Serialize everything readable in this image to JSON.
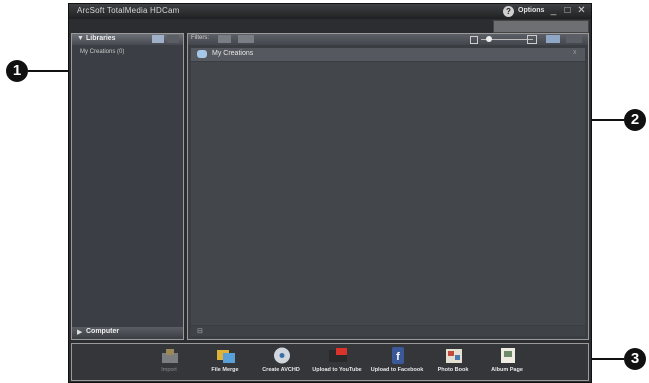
{
  "window": {
    "title": "ArcSoft TotalMedia HDCam",
    "options_label": "Options",
    "help_glyph": "?",
    "min_glyph": "_",
    "max_glyph": "□",
    "close_glyph": "✕"
  },
  "callouts": [
    "1",
    "2",
    "3"
  ],
  "left_panel": {
    "libraries_label": "Libraries",
    "libraries_items": [
      "My Creations (0)"
    ],
    "computer_label": "Computer",
    "expand_glyph": "▼",
    "collapsed_glyph": "▶"
  },
  "main_panel": {
    "filters_label": "Filters:",
    "section_title": "My Creations",
    "section_close_glyph": "x",
    "footer_glyph": "⊟"
  },
  "toolbar": {
    "items": [
      {
        "label": "Import",
        "icon": "import-icon",
        "enabled": false
      },
      {
        "label": "File Merge",
        "icon": "file-merge-icon",
        "enabled": true
      },
      {
        "label": "Create AVCHD",
        "icon": "disc-icon",
        "enabled": true
      },
      {
        "label": "Upload to YouTube",
        "icon": "youtube-icon",
        "enabled": true
      },
      {
        "label": "Upload to Facebook",
        "icon": "facebook-icon",
        "enabled": true
      },
      {
        "label": "Photo Book",
        "icon": "photo-book-icon",
        "enabled": true
      },
      {
        "label": "Album Page",
        "icon": "album-page-icon",
        "enabled": true
      }
    ]
  },
  "colors": {
    "accent": "#8fa6c5",
    "window_bg": "#2b2d30",
    "panel_bg": "#3a3d42"
  }
}
